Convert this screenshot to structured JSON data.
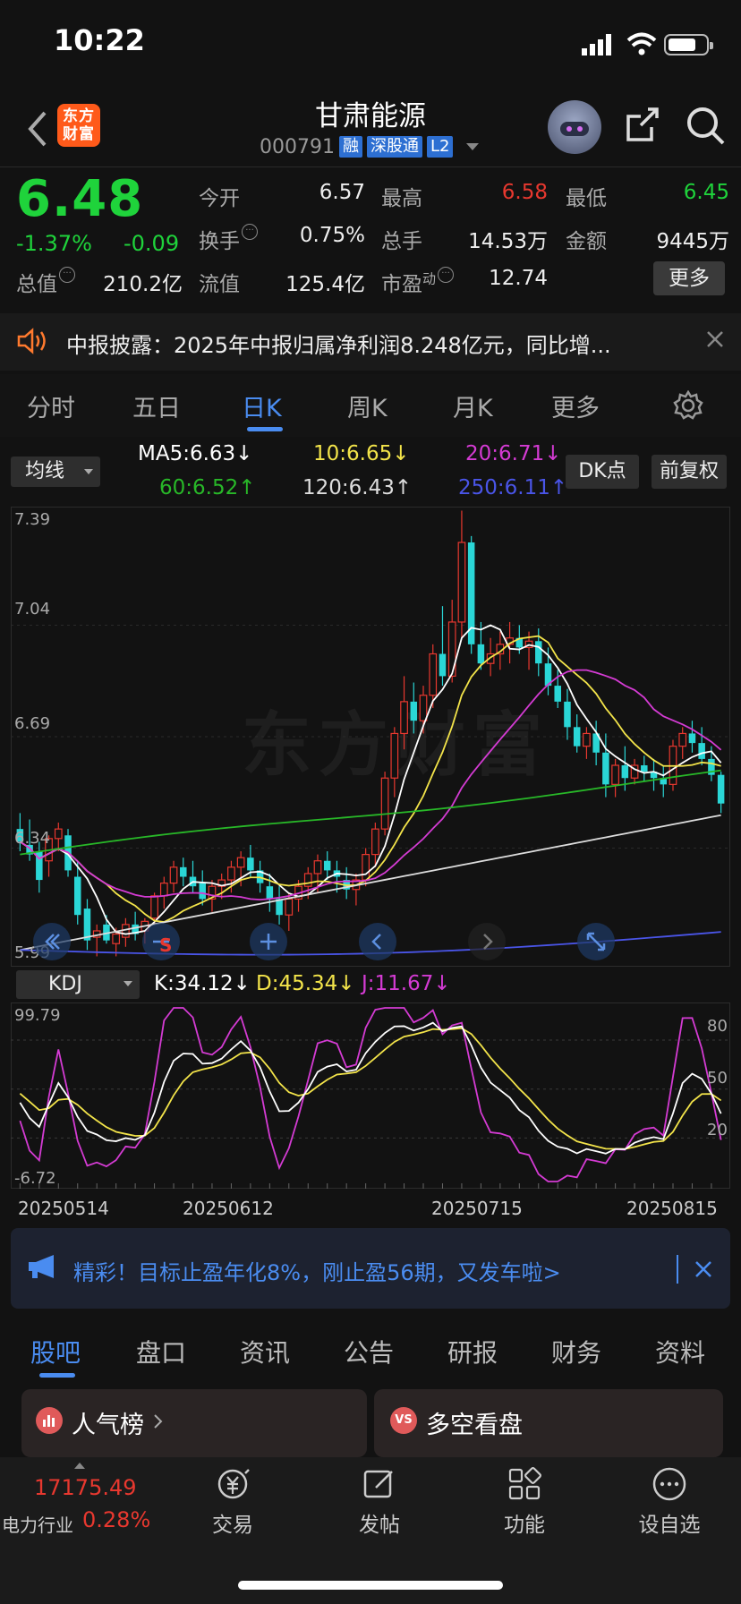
{
  "status": {
    "time": "10:22"
  },
  "header": {
    "logo_line1": "东方",
    "logo_line2": "财富",
    "title": "甘肃能源",
    "code": "000791",
    "tags": [
      "融",
      "深股通",
      "L2"
    ]
  },
  "quote": {
    "price": "6.48",
    "change_pct": "-1.37%",
    "change_amt": "-0.09",
    "rows": [
      [
        {
          "label": "今开",
          "value": "6.57"
        },
        {
          "label": "最高",
          "value": "6.58",
          "color": "#e8382f"
        },
        {
          "label": "最低",
          "value": "6.45",
          "color": "#1fd33b"
        }
      ],
      [
        {
          "label": "换手",
          "value": "0.75%"
        },
        {
          "label": "总手",
          "value": "14.53万"
        },
        {
          "label": "金额",
          "value": "9445万"
        }
      ],
      [
        {
          "label": "总值",
          "value": "210.2亿"
        },
        {
          "label": "流值",
          "value": "125.4亿"
        },
        {
          "label": "市盈",
          "sup": "动",
          "value": "12.74"
        }
      ]
    ],
    "more": "更多"
  },
  "notice": {
    "text": "中报披露：2025年中报归属净利润8.248亿元，同比增..."
  },
  "tabs": {
    "items": [
      "分时",
      "五日",
      "日K",
      "周K",
      "月K",
      "更多"
    ],
    "active": 2
  },
  "ma": {
    "select": "均线",
    "ma5": "MA5:6.63↓",
    "ma10": "10:6.65↓",
    "ma20": "20:6.71↓",
    "ma60": "60:6.52↑",
    "ma120": "120:6.43↑",
    "ma250": "250:6.11↑",
    "dk_btn": "DK点",
    "fq_btn": "前复权"
  },
  "chart": {
    "y_labels": [
      "7.39",
      "7.04",
      "6.69",
      "6.34",
      "5.99"
    ],
    "marker_s": "S"
  },
  "kdj": {
    "select": "KDJ",
    "k": "K:34.12↓",
    "d": "D:45.34↓",
    "j": "J:11.67↓",
    "y_top": "99.79",
    "y_bottom": "-6.72",
    "levels": [
      "80",
      "50",
      "20"
    ]
  },
  "dates": [
    "20250514",
    "20250612",
    "20250715",
    "20250815"
  ],
  "promo": {
    "text": "精彩！目标止盈年化8%，刚止盈56期，又发车啦>"
  },
  "bottom_tabs": {
    "items": [
      "股吧",
      "盘口",
      "资讯",
      "公告",
      "研报",
      "财务",
      "资料"
    ],
    "active": 0
  },
  "cards": {
    "left_title": "人气榜",
    "right_title": "多空看盘",
    "right_badge": "VS"
  },
  "nav": {
    "index_value": "17175.49",
    "index_name": "电力行业",
    "index_pct": "0.28%",
    "items": [
      "交易",
      "发帖",
      "功能",
      "设自选"
    ]
  },
  "chart_data": {
    "type": "candlestick",
    "y_range": [
      5.99,
      7.39
    ],
    "x_ticks": [
      "20250514",
      "20250612",
      "20250715",
      "20250815"
    ],
    "candles_ohlc": [
      [
        6.4,
        6.45,
        6.33,
        6.36
      ],
      [
        6.35,
        6.43,
        6.3,
        6.32
      ],
      [
        6.33,
        6.36,
        6.2,
        6.24
      ],
      [
        6.3,
        6.38,
        6.25,
        6.37
      ],
      [
        6.37,
        6.42,
        6.33,
        6.4
      ],
      [
        6.38,
        6.4,
        6.25,
        6.27
      ],
      [
        6.25,
        6.3,
        6.1,
        6.13
      ],
      [
        6.15,
        6.18,
        6.02,
        6.05
      ],
      [
        6.06,
        6.1,
        6.0,
        6.08
      ],
      [
        6.1,
        6.13,
        6.04,
        6.05
      ],
      [
        6.04,
        6.09,
        6.0,
        6.07
      ],
      [
        6.06,
        6.12,
        6.03,
        6.1
      ],
      [
        6.1,
        6.14,
        6.05,
        6.07
      ],
      [
        6.08,
        6.12,
        6.04,
        6.11
      ],
      [
        6.12,
        6.2,
        6.1,
        6.19
      ],
      [
        6.19,
        6.25,
        6.15,
        6.23
      ],
      [
        6.23,
        6.3,
        6.2,
        6.28
      ],
      [
        6.28,
        6.31,
        6.22,
        6.25
      ],
      [
        6.25,
        6.3,
        6.2,
        6.22
      ],
      [
        6.23,
        6.27,
        6.16,
        6.18
      ],
      [
        6.18,
        6.24,
        6.14,
        6.22
      ],
      [
        6.22,
        6.26,
        6.18,
        6.24
      ],
      [
        6.24,
        6.3,
        6.2,
        6.28
      ],
      [
        6.28,
        6.33,
        6.22,
        6.31
      ],
      [
        6.31,
        6.35,
        6.25,
        6.27
      ],
      [
        6.27,
        6.3,
        6.2,
        6.23
      ],
      [
        6.22,
        6.26,
        6.14,
        6.18
      ],
      [
        6.18,
        6.22,
        6.1,
        6.13
      ],
      [
        6.13,
        6.2,
        6.08,
        6.18
      ],
      [
        6.18,
        6.24,
        6.14,
        6.22
      ],
      [
        6.22,
        6.28,
        6.18,
        6.26
      ],
      [
        6.26,
        6.32,
        6.2,
        6.3
      ],
      [
        6.3,
        6.33,
        6.24,
        6.27
      ],
      [
        6.27,
        6.3,
        6.2,
        6.25
      ],
      [
        6.24,
        6.28,
        6.18,
        6.21
      ],
      [
        6.21,
        6.26,
        6.16,
        6.24
      ],
      [
        6.24,
        6.34,
        6.22,
        6.32
      ],
      [
        6.32,
        6.42,
        6.28,
        6.4
      ],
      [
        6.4,
        6.58,
        6.38,
        6.56
      ],
      [
        6.56,
        6.72,
        6.5,
        6.7
      ],
      [
        6.7,
        6.88,
        6.65,
        6.8
      ],
      [
        6.8,
        6.86,
        6.7,
        6.74
      ],
      [
        6.74,
        6.85,
        6.7,
        6.82
      ],
      [
        6.82,
        6.98,
        6.78,
        6.95
      ],
      [
        6.95,
        7.1,
        6.85,
        6.88
      ],
      [
        6.88,
        7.12,
        6.86,
        7.05
      ],
      [
        7.05,
        7.4,
        7.0,
        7.3
      ],
      [
        7.3,
        7.32,
        6.95,
        6.98
      ],
      [
        6.98,
        7.05,
        6.9,
        6.92
      ],
      [
        6.92,
        7.0,
        6.88,
        6.95
      ],
      [
        6.95,
        7.02,
        6.9,
        6.98
      ],
      [
        6.98,
        7.05,
        6.92,
        7.0
      ],
      [
        7.0,
        7.04,
        6.95,
        6.97
      ],
      [
        6.97,
        7.02,
        6.9,
        6.99
      ],
      [
        6.99,
        7.03,
        6.88,
        6.92
      ],
      [
        6.92,
        6.97,
        6.82,
        6.85
      ],
      [
        6.85,
        6.9,
        6.78,
        6.8
      ],
      [
        6.8,
        6.84,
        6.68,
        6.72
      ],
      [
        6.72,
        6.76,
        6.64,
        6.66
      ],
      [
        6.66,
        6.72,
        6.62,
        6.7
      ],
      [
        6.7,
        6.74,
        6.6,
        6.64
      ],
      [
        6.64,
        6.7,
        6.5,
        6.54
      ],
      [
        6.54,
        6.62,
        6.5,
        6.6
      ],
      [
        6.6,
        6.66,
        6.52,
        6.56
      ],
      [
        6.56,
        6.62,
        6.54,
        6.6
      ],
      [
        6.6,
        6.63,
        6.55,
        6.58
      ],
      [
        6.58,
        6.62,
        6.52,
        6.56
      ],
      [
        6.56,
        6.6,
        6.5,
        6.54
      ],
      [
        6.54,
        6.68,
        6.52,
        6.66
      ],
      [
        6.66,
        6.72,
        6.62,
        6.7
      ],
      [
        6.7,
        6.74,
        6.64,
        6.67
      ],
      [
        6.67,
        6.72,
        6.6,
        6.62
      ],
      [
        6.62,
        6.66,
        6.55,
        6.57
      ],
      [
        6.57,
        6.58,
        6.45,
        6.48
      ]
    ]
  }
}
